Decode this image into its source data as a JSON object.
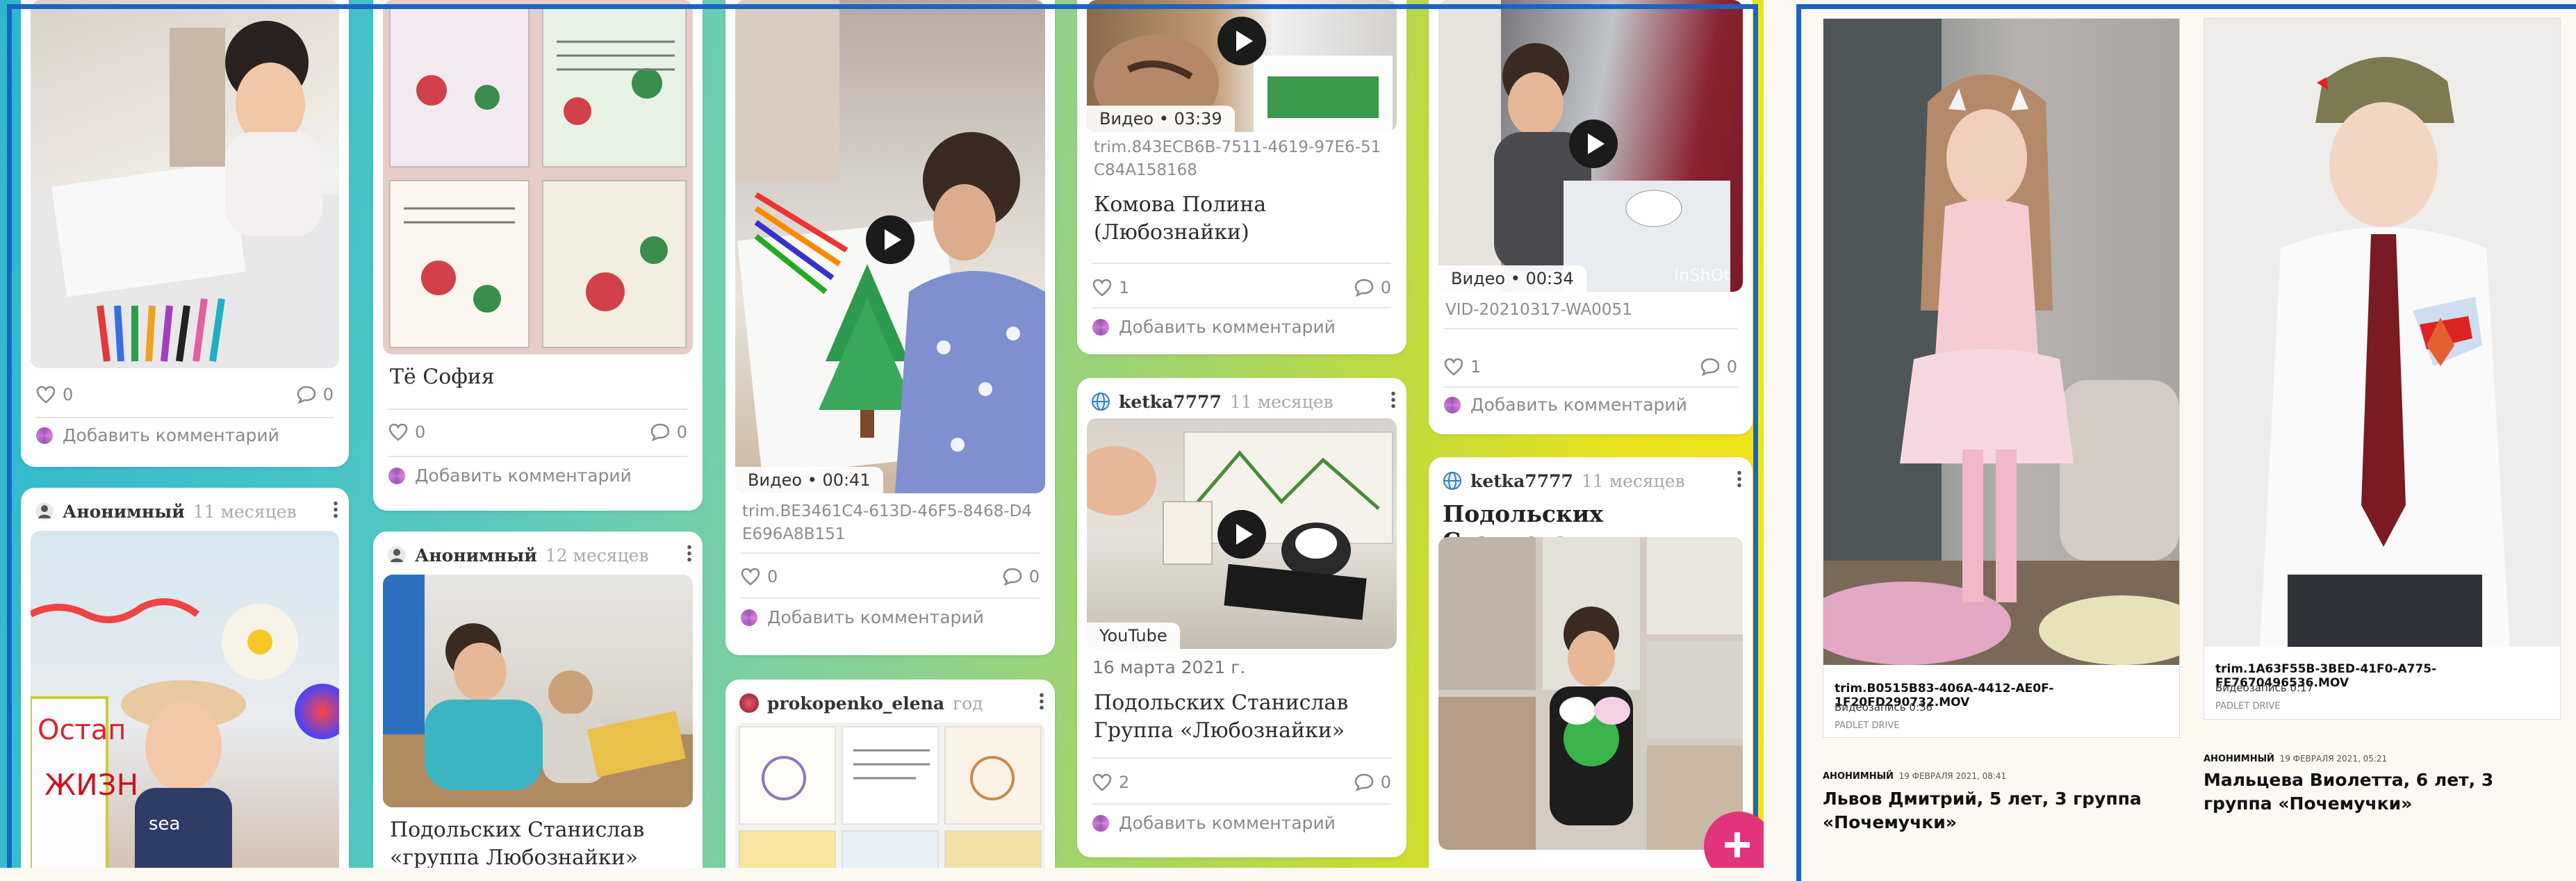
{
  "left_board": {
    "col1": {
      "card1": {
        "likes": "0",
        "comments": "0",
        "add_comment": "Добавить комментарий"
      },
      "card2": {
        "author": "Анонимный",
        "ago": "11 месяцев"
      }
    },
    "col2": {
      "card1": {
        "title": "Тё София",
        "likes": "0",
        "comments": "0",
        "add_comment": "Добавить комментарий"
      },
      "card2": {
        "author": "Анонимный",
        "ago": "12 месяцев",
        "title": "Подольских Станислав «группа Любознайки»"
      }
    },
    "col3": {
      "card1": {
        "badge": "Видео • 00:41",
        "filename": "trim.BE3461C4-613D-46F5-8468-D4E696A8B151",
        "likes": "0",
        "comments": "0",
        "add_comment": "Добавить комментарий"
      },
      "card2": {
        "author": "prokopenko_elena",
        "ago": "год"
      }
    },
    "col4": {
      "card1": {
        "badge": "Видео • 03:39",
        "filename": "trim.843ECB6B-7511-4619-97E6-51C84A158168",
        "title": "Комова Полина (Любознайки)",
        "likes": "1",
        "comments": "0",
        "add_comment": "Добавить комментарий"
      },
      "card2": {
        "author": "ketka7777",
        "ago": "11 месяцев",
        "badge": "YouTube",
        "date": "16 марта 2021 г.",
        "title": "Подольских Станислав Группа «Любознайки»",
        "likes": "2",
        "comments": "0",
        "add_comment": "Добавить комментарий"
      }
    },
    "col5": {
      "card1": {
        "badge": "Видео • 00:34",
        "watermark": "InShOt",
        "filename": "VID-20210317-WA0051",
        "likes": "1",
        "comments": "0",
        "add_comment": "Добавить комментарий"
      },
      "card2": {
        "author": "ketka7777",
        "ago": "11 месяцев",
        "title": "Подольских Станислав"
      }
    }
  },
  "right_board": {
    "video1": {
      "filename": "trim.B0515B83-406A-4412-AE0F-1F20FD290732.MOV",
      "duration": "Видеозапись 0:36",
      "source": "PADLET DRIVE",
      "author": "АНОНИМНЫЙ",
      "date": "19 ФЕВРАЛЯ 2021, 08:41",
      "title": "Львов Дмитрий, 5 лет, 3 группа «Почемучки»"
    },
    "video2": {
      "filename": "trim.1A63F55B-3BED-41F0-A775-FE7670496536.MOV",
      "duration": "Видеозапись 0:17",
      "source": "PADLET DRIVE",
      "author": "АНОНИМНЫЙ",
      "date": "19 ФЕВРАЛЯ 2021, 05:21",
      "title": "Мальцева Виолетта, 6 лет, 3 группа «Почемучки»"
    }
  }
}
